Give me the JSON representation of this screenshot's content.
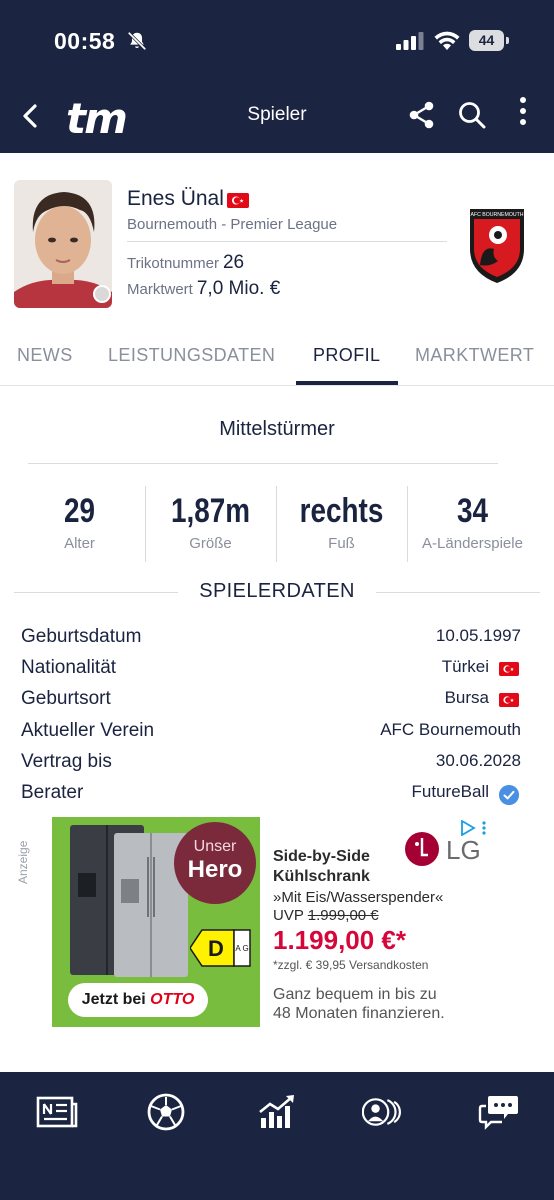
{
  "status_bar": {
    "time": "00:58",
    "battery": "44",
    "icons": [
      "bell-slash-icon",
      "signal-icon",
      "wifi-icon",
      "battery-icon"
    ]
  },
  "header": {
    "logo": "tm",
    "title": "Spieler",
    "icons": [
      "back-icon",
      "share-icon",
      "search-icon",
      "more-icon"
    ]
  },
  "player": {
    "name": "Enes Ünal",
    "club_league": "Bournemouth - Premier League",
    "shirt_label": "Trikotnummer",
    "shirt_number": "26",
    "value_label": "Marktwert",
    "value": "7,0 Mio. €",
    "crest_text": "AFC BOURNEMOUTH"
  },
  "tabs": [
    {
      "label": "NEWS",
      "active": false
    },
    {
      "label": "LEISTUNGSDATEN",
      "active": false
    },
    {
      "label": "PROFIL",
      "active": true
    },
    {
      "label": "MARKTWERT",
      "active": false
    }
  ],
  "position": "Mittelstürmer",
  "stats": [
    {
      "value": "29",
      "label": "Alter"
    },
    {
      "value": "1,87m",
      "label": "Größe"
    },
    {
      "value": "rechts",
      "label": "Fuß"
    },
    {
      "value": "34",
      "label": "A-Länderspiele"
    }
  ],
  "section_title": "SPIELERDATEN",
  "player_data": [
    {
      "key": "Geburtsdatum",
      "value": "10.05.1997"
    },
    {
      "key": "Nationalität",
      "value": "Türkei"
    },
    {
      "key": "Geburtsort",
      "value": "Bursa"
    },
    {
      "key": "Aktueller Verein",
      "value": "AFC Bournemouth"
    },
    {
      "key": "Vertrag bis",
      "value": "30.06.2028"
    },
    {
      "key": "Berater",
      "value": "FutureBall"
    }
  ],
  "ad": {
    "label": "Anzeige",
    "hero_line1": "Unser",
    "hero_line2": "Hero",
    "energy_class": "D",
    "energy_scale": "A G",
    "cta_prefix": "Jetzt bei",
    "cta_brand": "OTTO",
    "headline_1": "Side-by-Side",
    "headline_2": "Kühlschrank",
    "subline": "»Mit Eis/Wasserspender«",
    "uvp_label": "UVP",
    "uvp_price": "1.999,00 €",
    "price": "1.199,00 €*",
    "shipping": "*zzgl. € 39,95 Versandkosten",
    "finance_1": "Ganz bequem in bis zu",
    "finance_2": "48 Monaten finanzieren.",
    "brand": "LG"
  },
  "bottom_nav": [
    "news-icon",
    "football-icon",
    "stats-chart-icon",
    "players-icon",
    "chat-icon"
  ],
  "colors": {
    "header_bg": "#1b2440",
    "text_dark": "#1a2340",
    "text_muted": "#8a8f9c",
    "flag_red": "#e30a17",
    "ad_green": "#79bd3f",
    "ad_price_red": "#d6063a"
  }
}
